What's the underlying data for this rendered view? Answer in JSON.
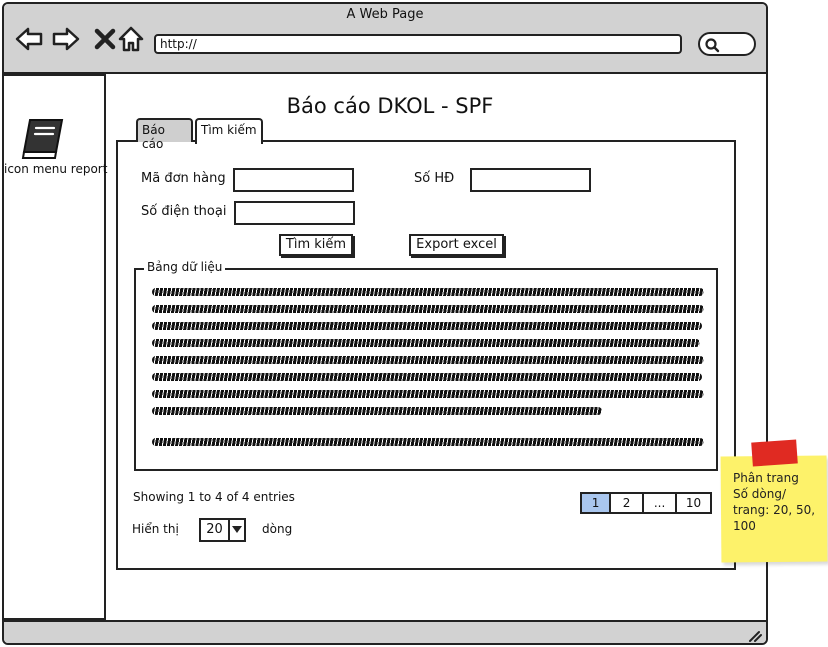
{
  "browser": {
    "title": "A Web Page",
    "url": "http://"
  },
  "sidebar": {
    "menu_label": "icon menu report"
  },
  "page": {
    "title": "Báo cáo DKOL - SPF"
  },
  "tabs": [
    {
      "label": "Báo cáo",
      "active": false
    },
    {
      "label": "Tìm kiếm",
      "active": true
    }
  ],
  "form": {
    "order_code_label": "Mã đơn hàng",
    "order_code_value": "",
    "contract_label": "Số HĐ",
    "contract_value": "",
    "phone_label": "Số điện thoại",
    "phone_value": "",
    "search_button": "Tìm kiếm",
    "export_button": "Export excel"
  },
  "table": {
    "legend": "Bảng dữ liệu"
  },
  "footer": {
    "entries": "Showing 1 to 4 of 4 entries",
    "show_label": "Hiển thị",
    "rows_selected": "20",
    "rows_suffix": "dòng"
  },
  "pagination": {
    "pages": [
      "1",
      "2",
      "...",
      "10"
    ],
    "active": "1"
  },
  "note": {
    "text": "Phân trang\nSố dòng/ trang: 20, 50, 100"
  },
  "colors": {
    "note": "#fdf26a",
    "tape": "#e02a22",
    "active_page": "#a9c6ee",
    "chrome": "#d2d2d2"
  },
  "icons": [
    "back-arrow-icon",
    "forward-arrow-icon",
    "close-icon",
    "home-icon",
    "search-icon",
    "book-icon",
    "chevron-down-icon"
  ]
}
